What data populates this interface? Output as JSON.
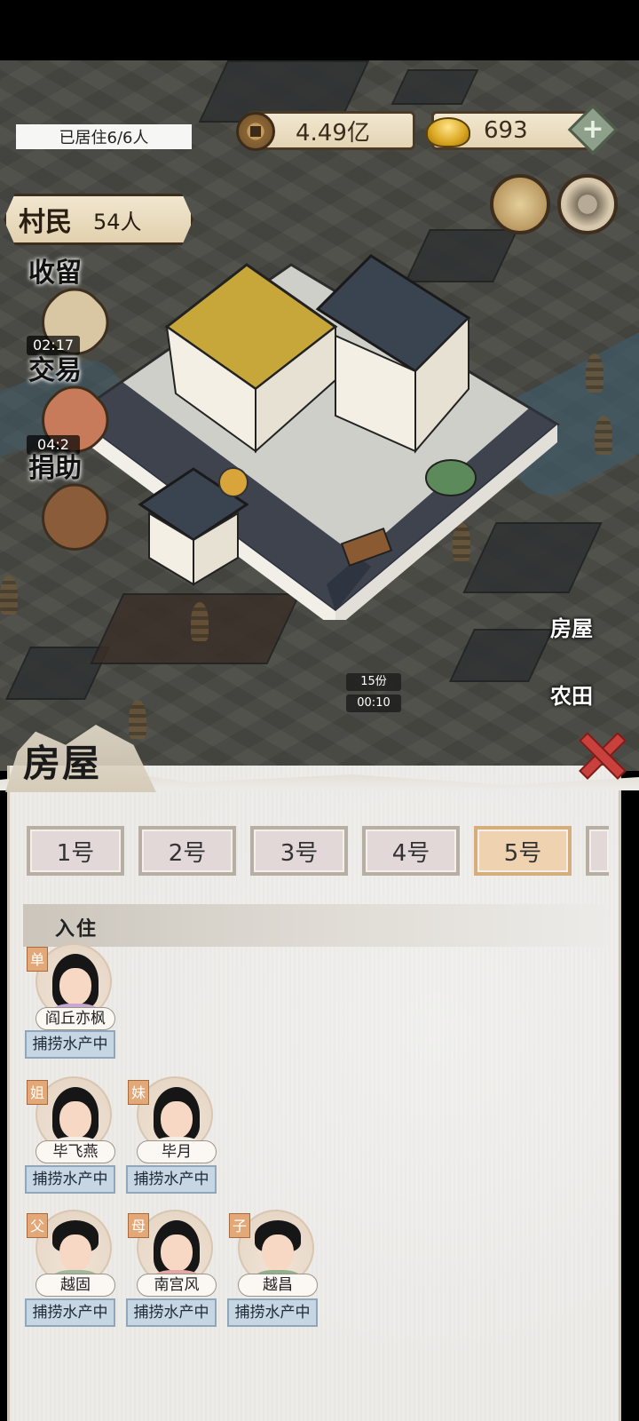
{
  "hud": {
    "resident_status": "已居住6/6人",
    "copper": "4.49亿",
    "gold": "693",
    "villagers_label": "村民",
    "villagers_count": "54人"
  },
  "side_buttons": [
    {
      "label": "收留",
      "timer": "02:17"
    },
    {
      "label": "交易",
      "timer": "04:2"
    },
    {
      "label": "捐助"
    }
  ],
  "right_labels": [
    "房屋",
    "农田"
  ],
  "map_tags": [
    "15份",
    "00:10"
  ],
  "panel": {
    "title": "房屋",
    "tabs": [
      "1号",
      "2号",
      "3号",
      "4号",
      "5号"
    ],
    "active_tab": "5号",
    "section_title": "入住",
    "residents": [
      {
        "tag": "单",
        "name": "阎丘亦枫",
        "status": "捕捞水产中"
      },
      {
        "tag": "姐",
        "name": "毕飞燕",
        "status": "捕捞水产中"
      },
      {
        "tag": "妹",
        "name": "毕月",
        "status": "捕捞水产中"
      },
      {
        "tag": "父",
        "name": "越固",
        "status": "捕捞水产中"
      },
      {
        "tag": "母",
        "name": "南宫风",
        "status": "捕捞水产中"
      },
      {
        "tag": "子",
        "name": "越昌",
        "status": "捕捞水产中"
      }
    ]
  },
  "colors": {
    "active_tab": "#efd3b1",
    "status_chip": "#c7d6e3",
    "close": "#c9413c"
  }
}
